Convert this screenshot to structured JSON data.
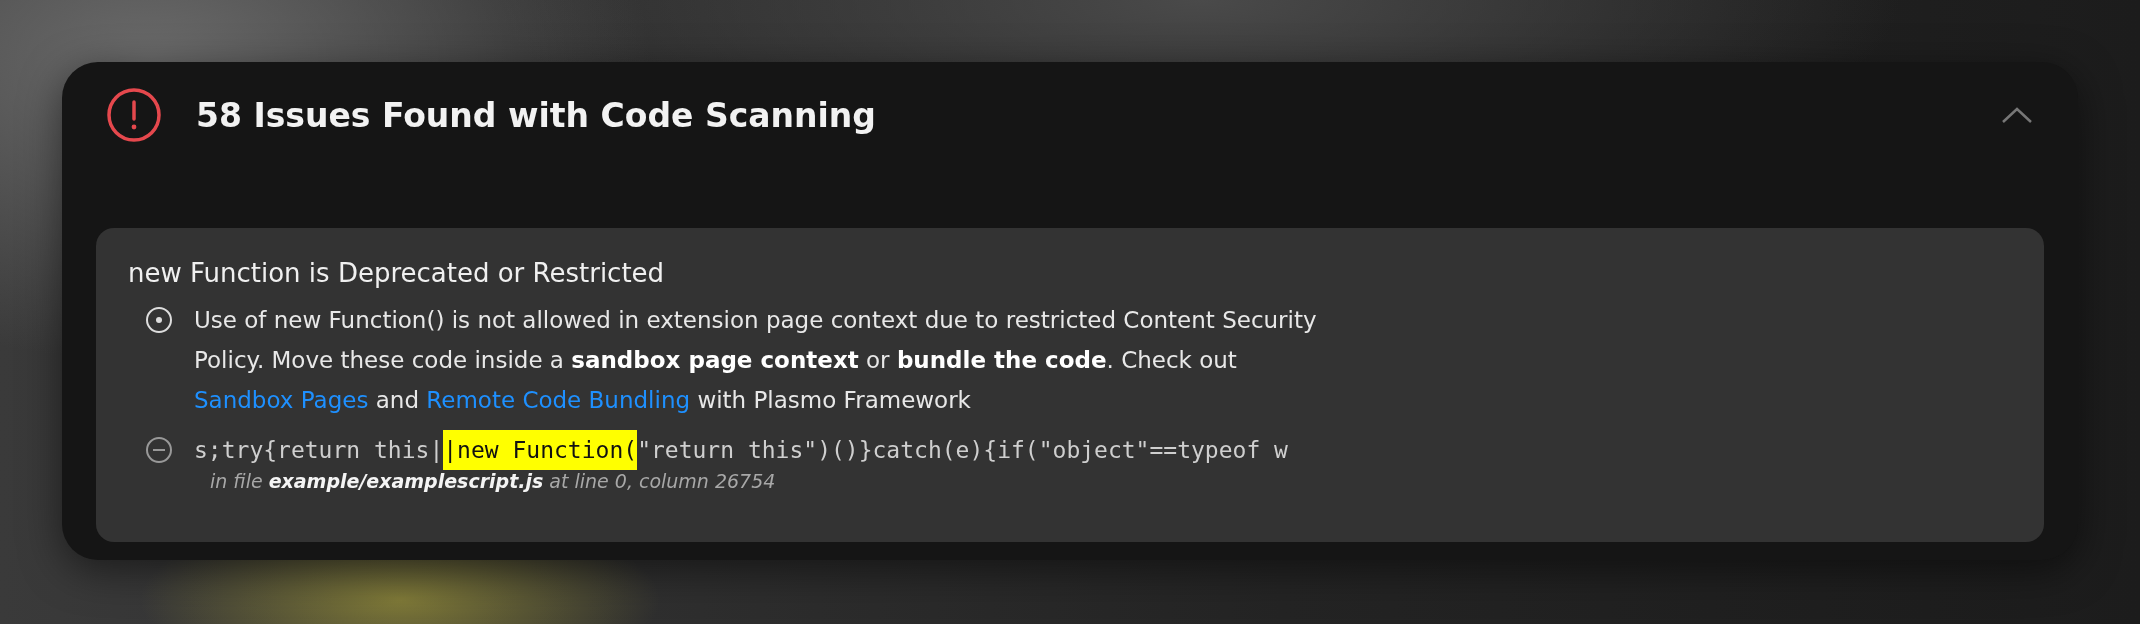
{
  "panel": {
    "title": "58 Issues Found with Code Scanning",
    "expanded": true
  },
  "issues": [
    {
      "title": "new Function is Deprecated or Restricted",
      "rows": [
        {
          "kind": "description",
          "segments": [
            {
              "kind": "text",
              "text": "Use of new Function() is not allowed in extension page context due to restricted Content Security Policy. Move these code inside a "
            },
            {
              "kind": "bold",
              "text": "sandbox page context"
            },
            {
              "kind": "text",
              "text": " or "
            },
            {
              "kind": "bold",
              "text": "bundle the code"
            },
            {
              "kind": "text",
              "text": ". Check out "
            },
            {
              "kind": "link",
              "text": "Sandbox Pages"
            },
            {
              "kind": "text",
              "text": " and "
            },
            {
              "kind": "link",
              "text": "Remote Code Bundling"
            },
            {
              "kind": "text",
              "text": " with Plasmo Framework"
            }
          ]
        },
        {
          "kind": "code",
          "before": "s;try{return this|",
          "highlight": "|new Function(",
          "after": "\"return this\")()}catch(e){if(\"object\"==typeof w",
          "location": "in file **example/examplescript.js** at line 0, column 26754"
        }
      ]
    }
  ]
}
